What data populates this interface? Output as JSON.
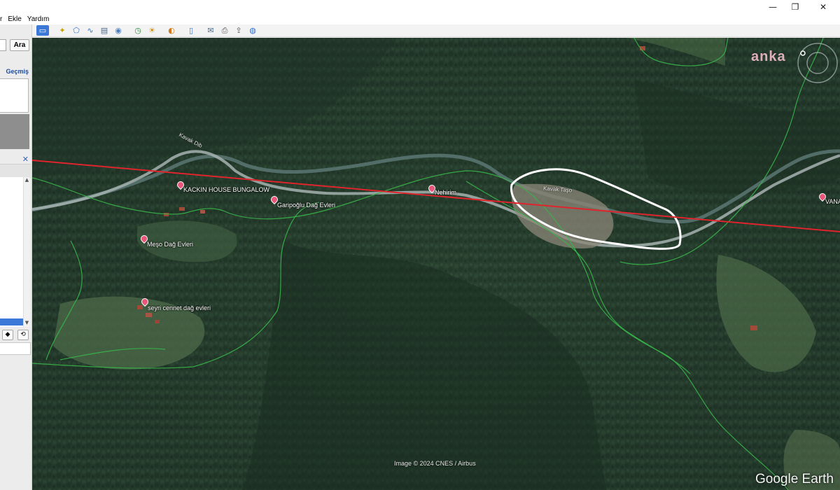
{
  "window": {
    "controls": {
      "minimize": "—",
      "maximize": "❐",
      "close": "✕"
    }
  },
  "menu": {
    "items": [
      {
        "label": "r"
      },
      {
        "label": "Ekle"
      },
      {
        "label": "Yardım"
      }
    ]
  },
  "toolbar": {
    "buttons": [
      {
        "icon": "sidebar-toggle-icon",
        "glyph": "▭",
        "active": true
      },
      {
        "icon": "add-placemark-icon",
        "glyph": "✦"
      },
      {
        "icon": "add-polygon-icon",
        "glyph": "⬠"
      },
      {
        "icon": "add-path-icon",
        "glyph": "∿"
      },
      {
        "icon": "image-overlay-icon",
        "glyph": "▤"
      },
      {
        "icon": "record-tour-icon",
        "glyph": "◉"
      },
      {
        "icon": "historical-imagery-icon",
        "glyph": "◷"
      },
      {
        "icon": "sunlight-icon",
        "glyph": "☀"
      },
      {
        "icon": "planets-icon",
        "glyph": "◐"
      },
      {
        "icon": "ruler-icon",
        "glyph": "▯"
      },
      {
        "icon": "email-icon",
        "glyph": "✉"
      },
      {
        "icon": "print-icon",
        "glyph": "⎙"
      },
      {
        "icon": "save-image-icon",
        "glyph": "⇪"
      },
      {
        "icon": "view-in-maps-icon",
        "glyph": "◍"
      }
    ]
  },
  "sidebar": {
    "search": {
      "value": "",
      "button_label": "Ara"
    },
    "history_label": "Geçmiş",
    "places_close": "✕",
    "actions": [
      "◆",
      "⟲"
    ]
  },
  "map": {
    "watermark": "anka",
    "attribution": "Image © 2024 CNES / Airbus",
    "brand": "Google Earth",
    "road_label": "Kavak Dib",
    "site_label": "Kavak Taşo",
    "places": [
      {
        "label": "KACKIN HOUSE BUNGALOW"
      },
      {
        "label": "Garipoğlu Dağ Evleri"
      },
      {
        "label": "Nehirim"
      },
      {
        "label": "Meşo Dağ Evleri"
      },
      {
        "label": "seyri cennet dağ evleri"
      },
      {
        "label": "VANA"
      }
    ],
    "colors": {
      "forest": "#24392a",
      "boundary": "#39b54a",
      "red_line": "#e0242c",
      "annotation": "#ffffff",
      "road": "#9aa7a5"
    }
  }
}
